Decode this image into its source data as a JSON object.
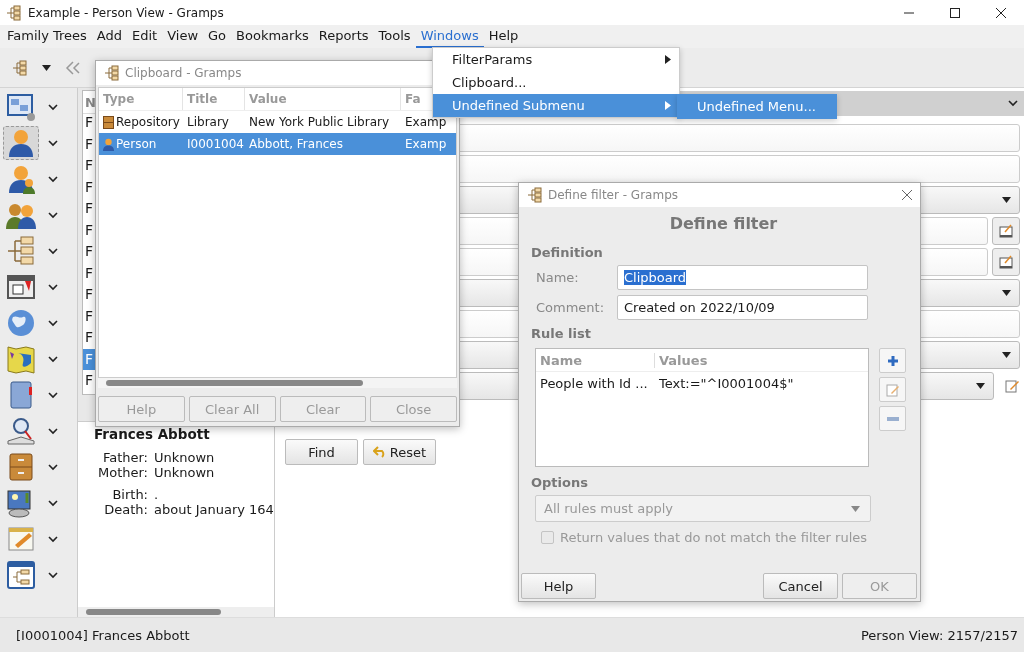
{
  "window": {
    "title": "Example - Person View - Gramps"
  },
  "menubar": [
    {
      "label": "Family Trees",
      "selected": false
    },
    {
      "label": "Add",
      "selected": false
    },
    {
      "label": "Edit",
      "selected": false
    },
    {
      "label": "View",
      "selected": false
    },
    {
      "label": "Go",
      "selected": false
    },
    {
      "label": "Bookmarks",
      "selected": false
    },
    {
      "label": "Reports",
      "selected": false
    },
    {
      "label": "Tools",
      "selected": false
    },
    {
      "label": "Windows",
      "selected": true
    },
    {
      "label": "Help",
      "selected": false
    }
  ],
  "windows_menu": {
    "items": [
      {
        "label": "FilterParams",
        "submenu": true,
        "selected": false
      },
      {
        "label": "Clipboard...",
        "submenu": false,
        "selected": false
      },
      {
        "label": "Undefined Submenu",
        "submenu": true,
        "selected": true
      }
    ],
    "submenu": [
      {
        "label": "Undefined Menu...",
        "selected": true
      }
    ]
  },
  "navigator": [
    {
      "kind": "dashboard",
      "selected": false
    },
    {
      "kind": "people",
      "selected": true
    },
    {
      "kind": "relationships",
      "selected": false
    },
    {
      "kind": "families",
      "selected": false
    },
    {
      "kind": "charts",
      "selected": false
    },
    {
      "kind": "events",
      "selected": false
    },
    {
      "kind": "places",
      "selected": false
    },
    {
      "kind": "geography",
      "selected": false
    },
    {
      "kind": "sources",
      "selected": false
    },
    {
      "kind": "citations",
      "selected": false
    },
    {
      "kind": "repositories",
      "selected": false
    },
    {
      "kind": "media",
      "selected": false
    },
    {
      "kind": "notes",
      "selected": false
    },
    {
      "kind": "other",
      "selected": false
    }
  ],
  "person_list": {
    "column": "N",
    "rows": [
      {
        "text": "F",
        "selected": false
      },
      {
        "text": "F",
        "selected": false
      },
      {
        "text": "F",
        "selected": false
      },
      {
        "text": "F",
        "selected": false
      },
      {
        "text": "F",
        "selected": false
      },
      {
        "text": "F",
        "selected": false
      },
      {
        "text": "F",
        "selected": false
      },
      {
        "text": "F",
        "selected": false
      },
      {
        "text": "F",
        "selected": false
      },
      {
        "text": "F",
        "selected": false
      },
      {
        "text": "F",
        "selected": false
      },
      {
        "text": "F",
        "selected": true
      },
      {
        "text": "F",
        "selected": false
      }
    ]
  },
  "details": {
    "name": "Frances Abbott",
    "parents": [
      {
        "label": "Father:",
        "value": "Unknown"
      },
      {
        "label": "Mother:",
        "value": "Unknown"
      }
    ],
    "events": [
      {
        "label": "Birth:",
        "value": "."
      },
      {
        "label": "Death:",
        "value": "about January 164"
      }
    ]
  },
  "filter_sidebar": {
    "fields": [
      {
        "kind": "entry"
      },
      {
        "kind": "entry"
      },
      {
        "kind": "combo"
      },
      {
        "kind": "entry_button"
      },
      {
        "kind": "entry_button"
      },
      {
        "kind": "combo"
      },
      {
        "kind": "entry"
      },
      {
        "kind": "combo"
      },
      {
        "kind": "combo_edit"
      }
    ],
    "buttons": [
      {
        "label": "Find",
        "kind": "plain"
      },
      {
        "label": "Reset",
        "kind": "undo"
      }
    ]
  },
  "clipboard": {
    "title": "Clipboard - Gramps",
    "columns": [
      "Type",
      "Title",
      "Value",
      "Fa"
    ],
    "rows": [
      {
        "kind": "repository",
        "type": "Repository",
        "title": "Library",
        "value": "New York Public Library",
        "column_4": "Examp",
        "selected": false
      },
      {
        "kind": "person",
        "type": "Person",
        "title": "I0001004",
        "value": "Abbott, Frances",
        "column_4": "Examp",
        "selected": true
      }
    ],
    "buttons": [
      {
        "label": "Help",
        "disabled": true
      },
      {
        "label": "Clear All",
        "disabled": true
      },
      {
        "label": "Clear",
        "disabled": true
      },
      {
        "label": "Close",
        "disabled": true
      }
    ]
  },
  "define_filter": {
    "title": "Define filter - Gramps",
    "heading": "Define filter",
    "definition_label": "Definition",
    "name_label": "Name:",
    "name_value": "Clipboard",
    "name_value_selected": true,
    "comment_label": "Comment:",
    "comment_value": "Created on 2022/10/09",
    "rule_list_label": "Rule list",
    "rule_columns": [
      "Name",
      "Values"
    ],
    "rules": [
      {
        "name": "People with Id ...",
        "values": "Text:=\"^I0001004$\""
      }
    ],
    "rule_buttons": [
      {
        "kind": "add"
      },
      {
        "kind": "edit"
      },
      {
        "kind": "remove"
      }
    ],
    "options_label": "Options",
    "option_combo": {
      "value": "All rules must apply",
      "disabled": true
    },
    "invert": {
      "label": "Return values that do not match the filter rules",
      "checked": false,
      "disabled": true
    },
    "buttons": [
      {
        "label": "Help",
        "disabled": false
      },
      {
        "label": "Cancel",
        "disabled": false
      },
      {
        "label": "OK",
        "disabled": true
      }
    ]
  },
  "status_bar": {
    "left": "[I0001004] Frances Abbott",
    "right": "Person View: 2157/2157"
  }
}
